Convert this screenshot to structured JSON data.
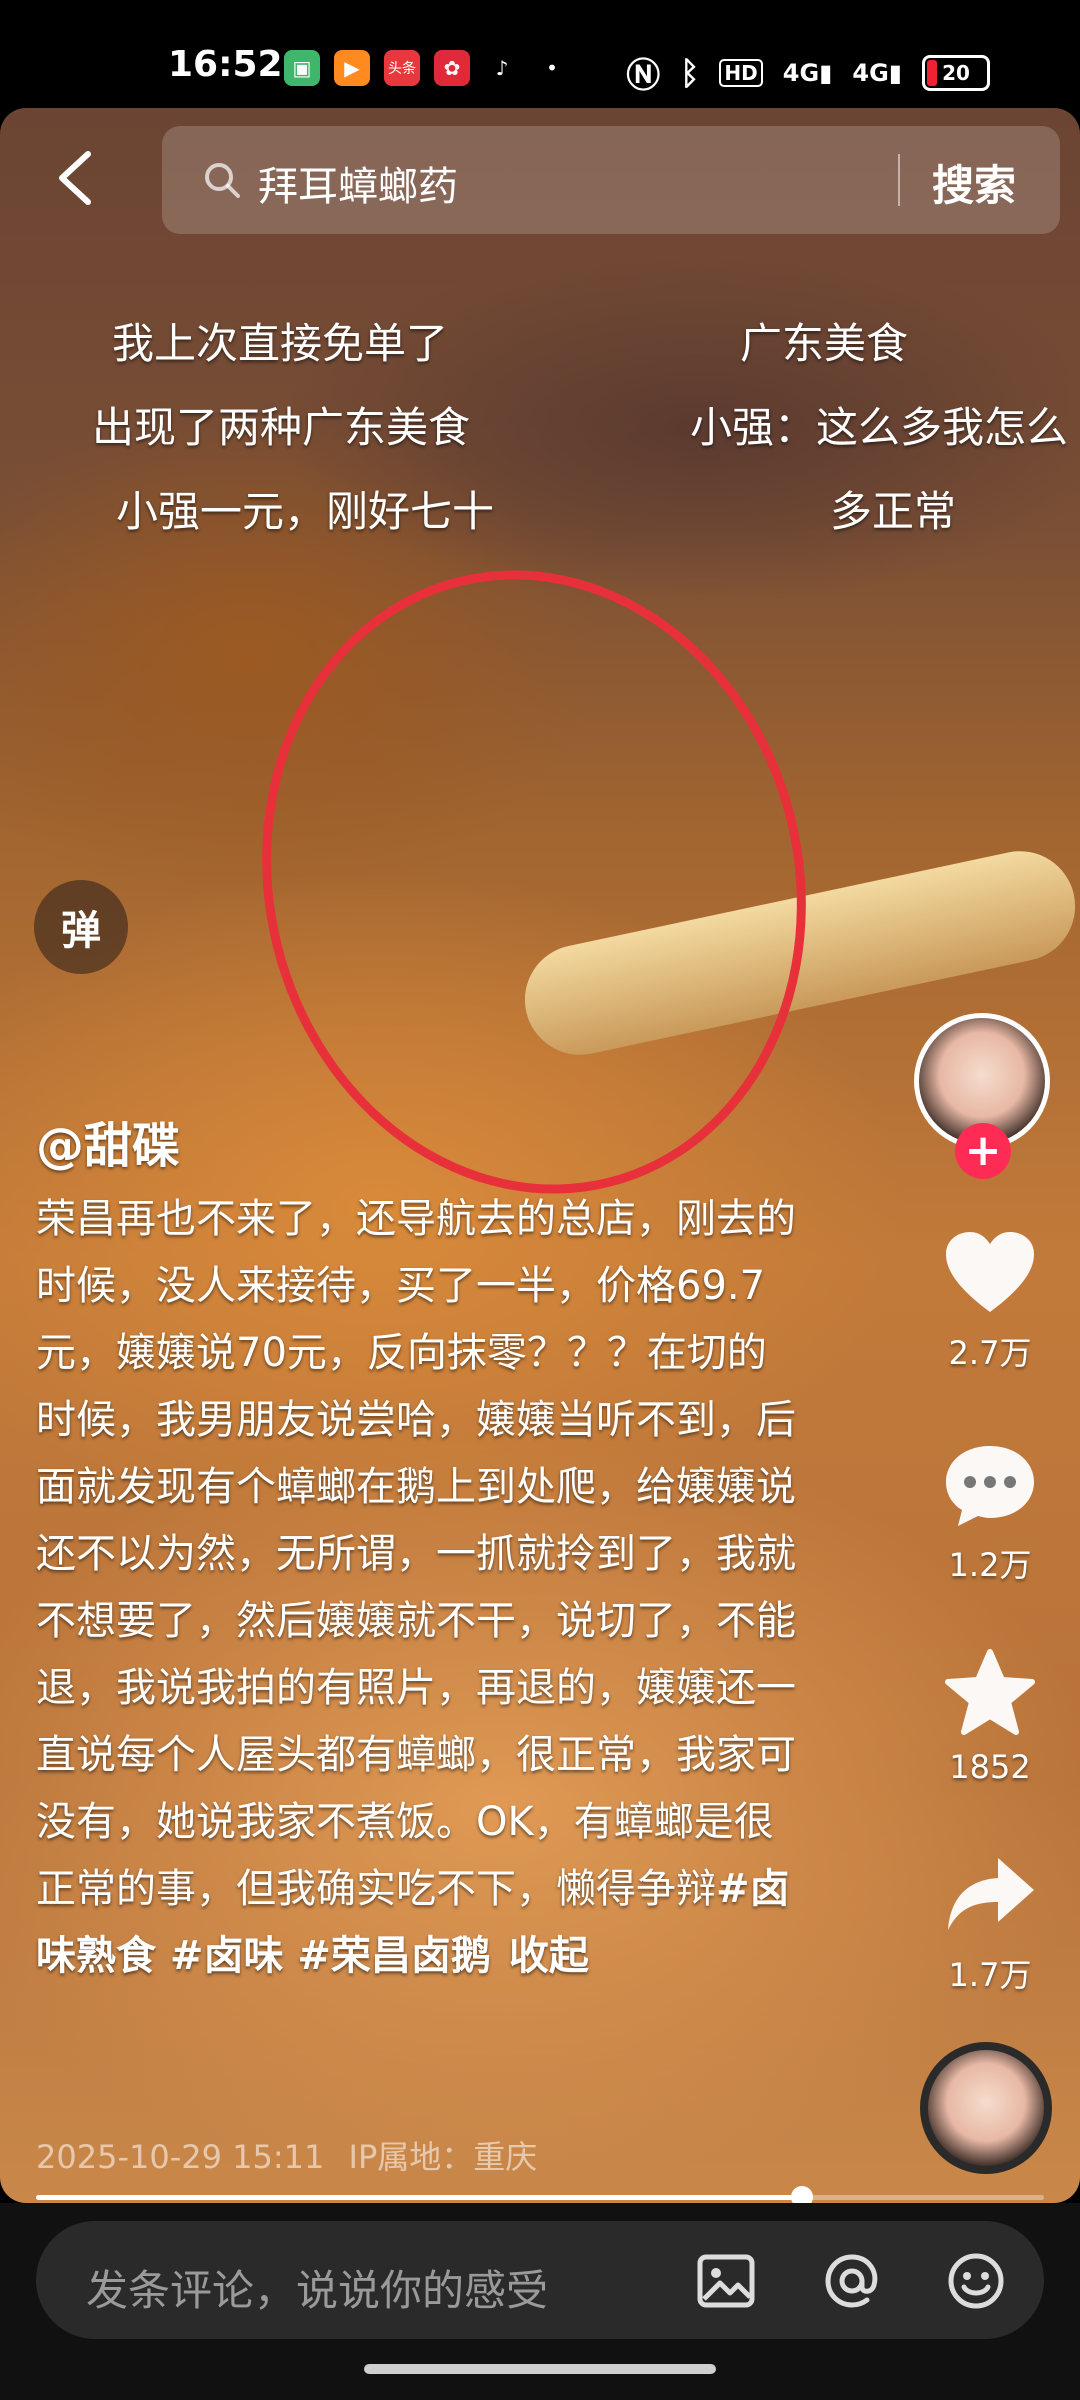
{
  "status_bar": {
    "time": "16:52",
    "apps": [
      {
        "name": "app-green-icon",
        "color": "#3fb66b",
        "glyph": "▣"
      },
      {
        "name": "app-orange-icon",
        "color": "#ff8a1f",
        "glyph": "▶"
      },
      {
        "name": "toutiao-icon",
        "color": "#e8383d",
        "glyph": "头条"
      },
      {
        "name": "app-red-icon",
        "color": "#e02a3a",
        "glyph": "✿"
      }
    ],
    "hd": "HD",
    "net1": "4G",
    "net2": "4G",
    "battery": "20"
  },
  "search": {
    "query": "拜耳蟑螂药",
    "button": "搜索"
  },
  "danmu": [
    "我上次直接免单了",
    "广东美食",
    "出现了两种广东美食",
    "小强：这么多我怎么",
    "小强一元，刚好七十",
    "多正常"
  ],
  "danmu_toggle": "弹",
  "video": {
    "author": "@甜碟",
    "description": "荣昌再也不来了，还导航去的总店，刚去的时候，没人来接待，买了一半，价格69.7元，嬢嬢说70元，反向抹零？？？在切的时候，我男朋友说尝哈，嬢嬢当听不到，后面就发现有个蟑螂在鹅上到处爬，给嬢嬢说还不以为然，无所谓，一抓就拎到了，我就不想要了，然后嬢嬢就不干，说切了，不能退，我说我拍的有照片，再退的，嬢嬢还一直说每个人屋头都有蟑螂，很正常，我家可没有，她说我家不煮饭。OK，有蟑螂是很正常的事，但我确实吃不下，懒得争辩",
    "hashtags": "#卤味熟食 #卤味 #荣昌卤鹅",
    "collapse": "收起",
    "time": "2025-10-29 15:11",
    "ip": "IP属地：重庆",
    "progress": 0.76
  },
  "actions": {
    "likes": "2.7万",
    "comments": "1.2万",
    "favorites": "1852",
    "shares": "1.7万",
    "follow_symbol": "+"
  },
  "comment_bar": {
    "placeholder": "发条评论，说说你的感受"
  }
}
